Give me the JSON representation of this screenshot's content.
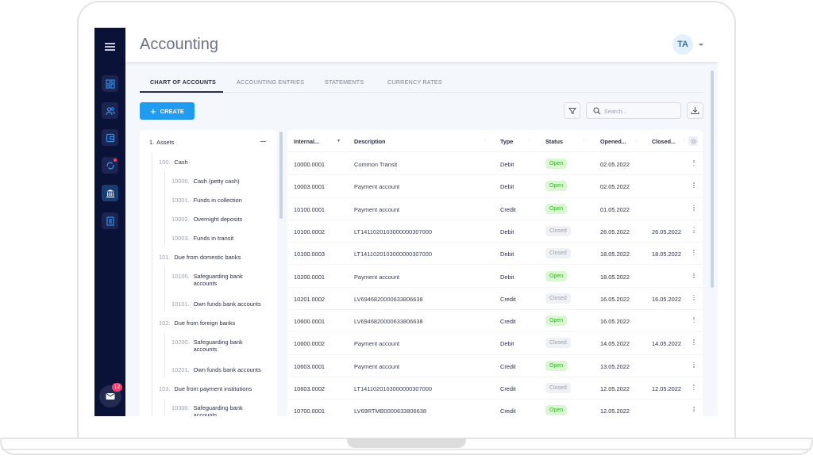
{
  "app": {
    "title": "Accounting",
    "user_initials": "TA",
    "mail_badge_count": "12"
  },
  "sidebar": {
    "items": [
      {
        "icon": "dashboard-icon",
        "active": false
      },
      {
        "icon": "users-icon",
        "active": false
      },
      {
        "icon": "wallet-icon",
        "active": false
      },
      {
        "icon": "sync-icon",
        "active": false,
        "notification": true
      },
      {
        "icon": "bank-icon",
        "active": true
      },
      {
        "icon": "document-icon",
        "active": false
      }
    ]
  },
  "tabs": [
    {
      "label": "CHART OF ACCOUNTS",
      "active": true
    },
    {
      "label": "ACCOUNTING ENTRIES",
      "active": false
    },
    {
      "label": "STATEMENTS",
      "active": false
    },
    {
      "label": "CURRENCY RATES",
      "active": false
    }
  ],
  "toolbar": {
    "create_label": "CREATE",
    "search_placeholder": "Search..."
  },
  "tree": {
    "items": [
      {
        "level": 0,
        "code": "1.",
        "label": "Assets"
      },
      {
        "level": 1,
        "code": "100.",
        "label": "Cash"
      },
      {
        "level": 2,
        "code": "10000.",
        "label": "Cash (petty cash)"
      },
      {
        "level": 2,
        "code": "10001.",
        "label": "Funds in collection"
      },
      {
        "level": 2,
        "code": "10002.",
        "label": "Overnight deposits"
      },
      {
        "level": 2,
        "code": "10003.",
        "label": "Funds in transit"
      },
      {
        "level": 1,
        "code": "101.",
        "label": "Due from domestic banks"
      },
      {
        "level": 2,
        "code": "10100.",
        "label": "Safeguarding bank accounts"
      },
      {
        "level": 2,
        "code": "10101.",
        "label": "Own funds bank accounts"
      },
      {
        "level": 1,
        "code": "102.",
        "label": "Due from foreign banks"
      },
      {
        "level": 2,
        "code": "10200.",
        "label": "Safeguarding bank accounts"
      },
      {
        "level": 2,
        "code": "10201.",
        "label": "Own funds bank accounts"
      },
      {
        "level": 1,
        "code": "103.",
        "label": "Due from payment institutions"
      },
      {
        "level": 2,
        "code": "10300.",
        "label": "Safeguarding bank accounts"
      }
    ]
  },
  "table": {
    "columns": [
      "Internal...",
      "Description",
      "Type",
      "Status",
      "Opened...",
      "Closed..."
    ],
    "rows": [
      {
        "internal": "10000.0001",
        "description": "Common Transit",
        "type": "Debit",
        "status": "Open",
        "opened": "02.05.2022",
        "closed": ""
      },
      {
        "internal": "10003.0001",
        "description": "Payment account",
        "type": "Debit",
        "status": "Open",
        "opened": "02.05.2022",
        "closed": ""
      },
      {
        "internal": "10100.0001",
        "description": "Payment account",
        "type": "Credit",
        "status": "Open",
        "opened": "01.05.2022",
        "closed": ""
      },
      {
        "internal": "10100.0002",
        "description": "LT141102010300000030700​0",
        "type": "Debit",
        "status": "Closed",
        "opened": "26.05.2022",
        "closed": "26.05.2022"
      },
      {
        "internal": "10100.0003",
        "description": "LT1411020103000000307000",
        "type": "Debit",
        "status": "Closed",
        "opened": "18.05.2022",
        "closed": "18.05.2022"
      },
      {
        "internal": "10200.0001",
        "description": "Payment account",
        "type": "Debit",
        "status": "Open",
        "opened": "18.05.2022",
        "closed": ""
      },
      {
        "internal": "10201.0002",
        "description": "LV6946820000633806638",
        "type": "Credit",
        "status": "Closed",
        "opened": "16.05.2022",
        "closed": "16.05.2022"
      },
      {
        "internal": "10600.0001",
        "description": "LV6946820000633806638",
        "type": "Credit",
        "status": "Open",
        "opened": "16.05.2022",
        "closed": ""
      },
      {
        "internal": "10600.0002",
        "description": "Payment account",
        "type": "Debit",
        "status": "Closed",
        "opened": "14.05.2022",
        "closed": "14.05.2022"
      },
      {
        "internal": "10603.0001",
        "description": "Payment account",
        "type": "Credit",
        "status": "Open",
        "opened": "13.05.2022",
        "closed": ""
      },
      {
        "internal": "10603.0002",
        "description": "LT1411020103000000307000",
        "type": "Credit",
        "status": "Closed",
        "opened": "12.05.2022",
        "closed": "12.05.2022"
      },
      {
        "internal": "10700.0001",
        "description": "LV69RTMB0000633806638",
        "type": "Credit",
        "status": "Open",
        "opened": "12.05.2022",
        "closed": ""
      }
    ]
  },
  "colors": {
    "sidebar_bg": "#0b1238",
    "accent": "#1f9cf0",
    "open_badge": "#37b22d",
    "closed_badge": "#9aa0b0",
    "notification": "#ff3b6b"
  }
}
